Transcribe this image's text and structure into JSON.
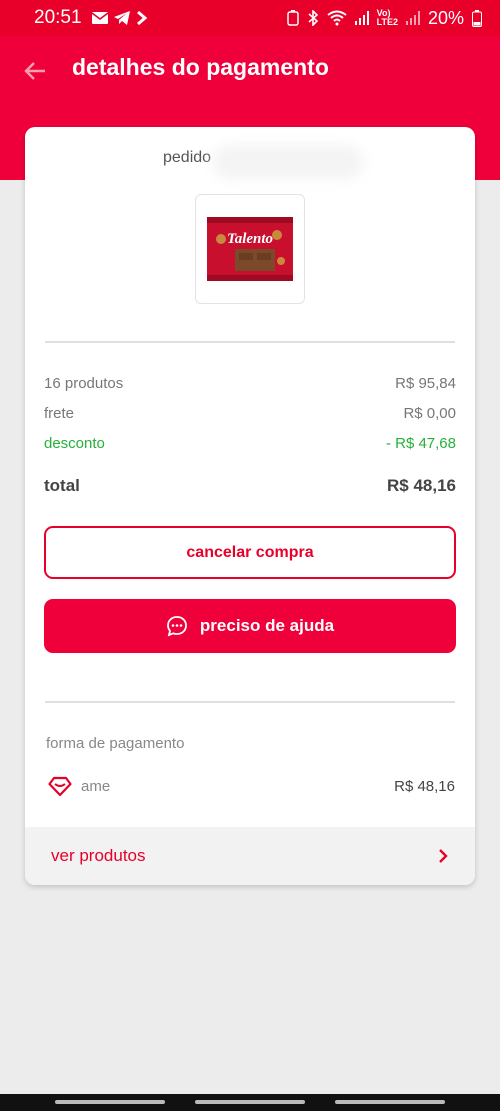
{
  "status_bar": {
    "time": "20:51",
    "network": "Vo)\nLTE2",
    "battery": "20%"
  },
  "header": {
    "title": "detalhes do pagamento"
  },
  "order": {
    "label": "pedido"
  },
  "product": {
    "brand": "Talento"
  },
  "summary": {
    "products_label": "16 produtos",
    "products_value": "R$ 95,84",
    "shipping_label": "frete",
    "shipping_value": "R$ 0,00",
    "discount_label": "desconto",
    "discount_value": "- R$ 47,68",
    "total_label": "total",
    "total_value": "R$ 48,16"
  },
  "actions": {
    "cancel_label": "cancelar compra",
    "help_label": "preciso de ajuda"
  },
  "payment": {
    "title": "forma de pagamento",
    "method": "ame",
    "amount": "R$ 48,16"
  },
  "footer": {
    "view_products_label": "ver produtos"
  },
  "colors": {
    "brand": "#f0003a",
    "discount": "#26b13b"
  }
}
